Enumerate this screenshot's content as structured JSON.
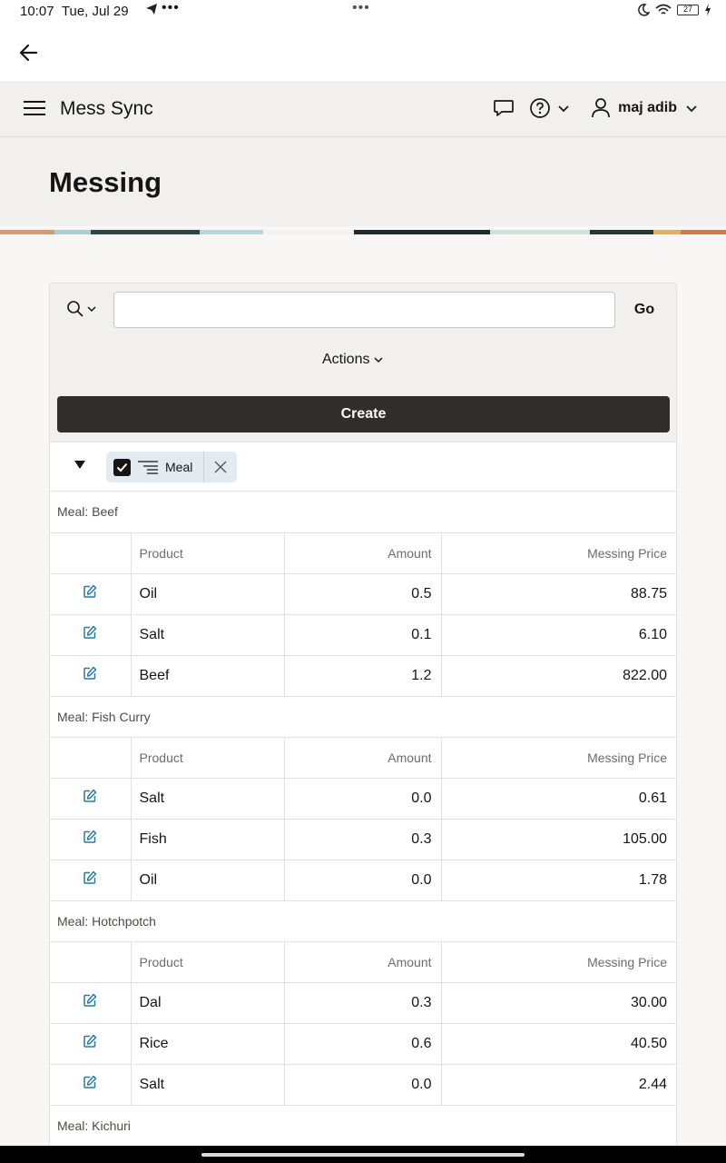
{
  "status_bar": {
    "time": "10:07",
    "date": "Tue, Jul 29",
    "battery": "27"
  },
  "header": {
    "app_title": "Mess Sync",
    "username": "maj adib"
  },
  "page": {
    "title": "Messing"
  },
  "toolbar": {
    "search_value": "",
    "go_label": "Go",
    "actions_label": "Actions",
    "create_label": "Create"
  },
  "filter_chip": {
    "label": "Meal"
  },
  "columns": {
    "product": "Product",
    "amount": "Amount",
    "price": "Messing Price"
  },
  "groups": [
    {
      "label": "Meal: Beef",
      "rows": [
        {
          "product": "Oil",
          "amount": "0.5",
          "price": "88.75"
        },
        {
          "product": "Salt",
          "amount": "0.1",
          "price": "6.10"
        },
        {
          "product": "Beef",
          "amount": "1.2",
          "price": "822.00"
        }
      ]
    },
    {
      "label": "Meal: Fish Curry",
      "rows": [
        {
          "product": "Salt",
          "amount": "0.0",
          "price": "0.61"
        },
        {
          "product": "Fish",
          "amount": "0.3",
          "price": "105.00"
        },
        {
          "product": "Oil",
          "amount": "0.0",
          "price": "1.78"
        }
      ]
    },
    {
      "label": "Meal: Hotchpotch",
      "rows": [
        {
          "product": "Dal",
          "amount": "0.3",
          "price": "30.00"
        },
        {
          "product": "Rice",
          "amount": "0.6",
          "price": "40.50"
        },
        {
          "product": "Salt",
          "amount": "0.0",
          "price": "2.44"
        }
      ]
    },
    {
      "label": "Meal: Kichuri",
      "rows": []
    }
  ]
}
